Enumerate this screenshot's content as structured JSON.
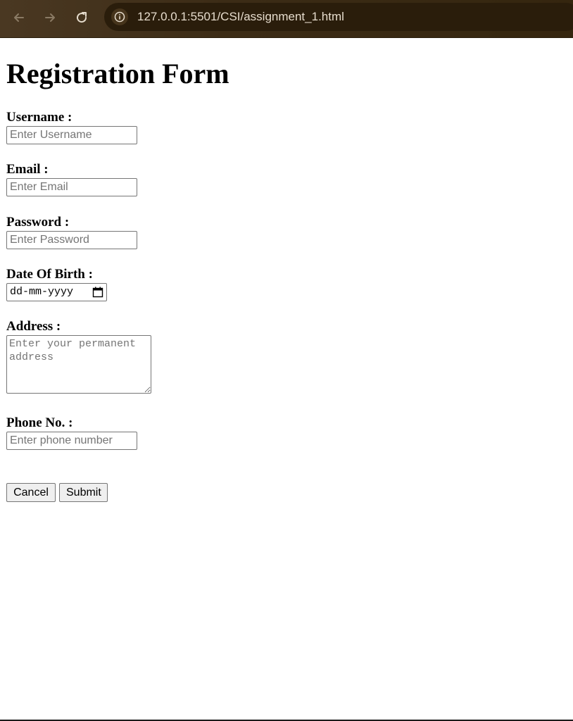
{
  "browser": {
    "url": "127.0.0.1:5501/CSI/assignment_1.html",
    "icons": {
      "back": "arrow-left",
      "forward": "arrow-right",
      "reload": "reload",
      "site_info": "info"
    }
  },
  "form": {
    "title": "Registration Form",
    "fields": {
      "username": {
        "label": "Username :",
        "placeholder": "Enter Username",
        "value": ""
      },
      "email": {
        "label": "Email :",
        "placeholder": "Enter Email",
        "value": ""
      },
      "password": {
        "label": "Password :",
        "placeholder": "Enter Password",
        "value": ""
      },
      "dob": {
        "label": "Date Of Birth :",
        "display": "dd-mm-yyyy"
      },
      "address": {
        "label": "Address :",
        "placeholder": "Enter your permanent address"
      },
      "phone": {
        "label": "Phone No. :",
        "placeholder": "Enter phone number",
        "value": ""
      }
    },
    "buttons": {
      "cancel": "Cancel",
      "submit": "Submit"
    }
  },
  "colors": {
    "toolbar": "#3c2c16",
    "urlbar": "#2a1d0b",
    "url_text": "#e6dccd",
    "placeholder": "#757575",
    "button_bg": "#efefef"
  }
}
